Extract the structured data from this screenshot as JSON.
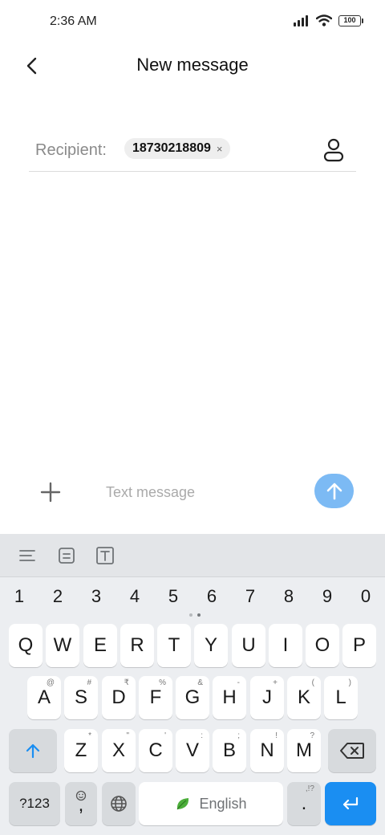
{
  "status_bar": {
    "time": "2:36 AM",
    "battery": "100"
  },
  "header": {
    "title": "New message"
  },
  "recipient": {
    "label": "Recipient:",
    "chip": "18730218809",
    "chip_remove": "×"
  },
  "composer": {
    "placeholder": "Text message"
  },
  "keyboard": {
    "numbers": [
      "1",
      "2",
      "3",
      "4",
      "5",
      "6",
      "7",
      "8",
      "9",
      "0"
    ],
    "row1": [
      "Q",
      "W",
      "E",
      "R",
      "T",
      "Y",
      "U",
      "I",
      "O",
      "P"
    ],
    "row2": [
      "A",
      "S",
      "D",
      "F",
      "G",
      "H",
      "J",
      "K",
      "L"
    ],
    "row2_secondary": [
      "@",
      "#",
      "₹",
      "%",
      "&",
      "-",
      "+",
      "(",
      ")"
    ],
    "row3": [
      "Z",
      "X",
      "C",
      "V",
      "B",
      "N",
      "M"
    ],
    "row3_secondary": [
      "*",
      "\"",
      "'",
      ":",
      ";",
      "!",
      "?"
    ],
    "symbols_key": "?123",
    "comma_key": ",",
    "space_label": "English",
    "period_key": ".",
    "period_secondary": ",!?"
  }
}
